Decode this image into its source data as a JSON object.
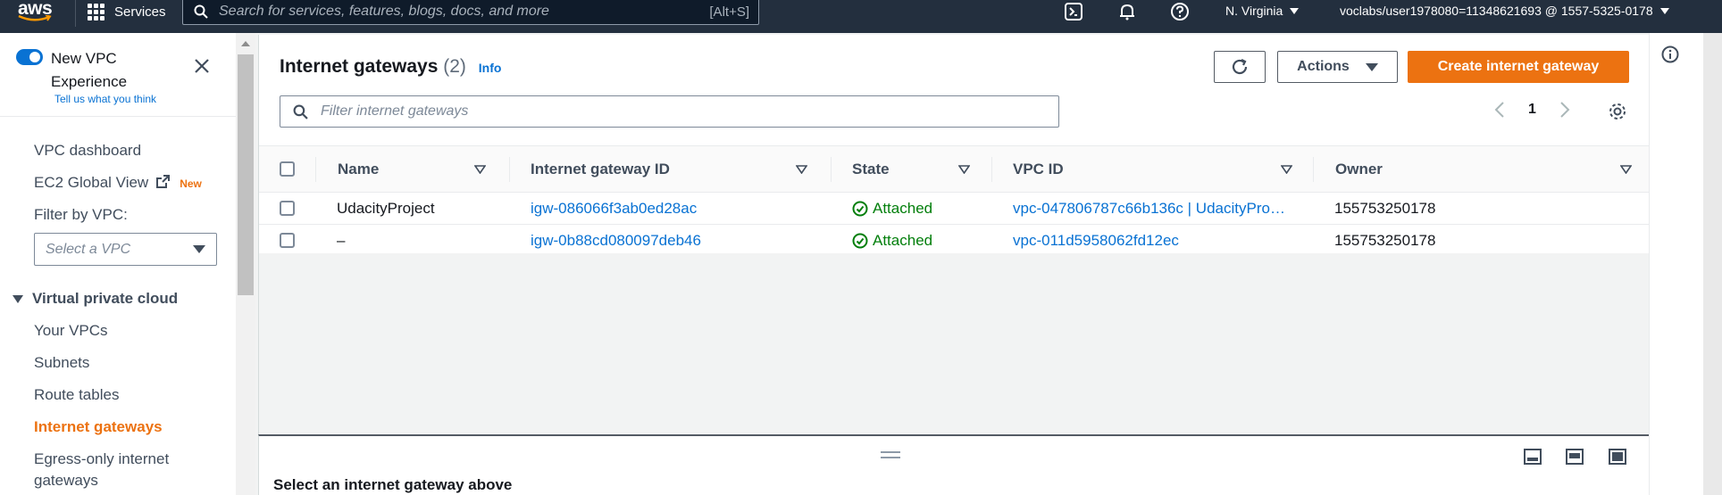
{
  "topnav": {
    "logo": "aws",
    "services_label": "Services",
    "search_placeholder": "Search for services, features, blogs, docs, and more",
    "search_shortcut": "[Alt+S]",
    "region": "N. Virginia",
    "account": "voclabs/user1978080=11348621693 @ 1557-5325-0178"
  },
  "sidebar": {
    "new_vpc_experience": "New VPC Experience",
    "feedback_link": "Tell us what you think",
    "vpc_dashboard": "VPC dashboard",
    "ec2_global_view": "EC2 Global View",
    "new_badge": "New",
    "filter_label": "Filter by VPC:",
    "filter_placeholder": "Select a VPC",
    "section_title": "Virtual private cloud",
    "items": [
      {
        "label": "Your VPCs",
        "active": false
      },
      {
        "label": "Subnets",
        "active": false
      },
      {
        "label": "Route tables",
        "active": false
      },
      {
        "label": "Internet gateways",
        "active": true
      },
      {
        "label": "Egress-only internet",
        "active": false
      }
    ],
    "egress_line2": "gateways"
  },
  "main": {
    "title": "Internet gateways",
    "count": "(2)",
    "info_link": "Info",
    "actions_label": "Actions",
    "create_label": "Create internet gateway",
    "filter_placeholder": "Filter internet gateways",
    "page_number": "1",
    "columns": [
      "Name",
      "Internet gateway ID",
      "State",
      "VPC ID",
      "Owner"
    ],
    "rows": [
      {
        "name": "UdacityProject",
        "igw_id": "igw-086066f3ab0ed28ac",
        "state": "Attached",
        "vpc_id": "vpc-047806787c66b136c | UdacityPro…",
        "owner": "155753250178"
      },
      {
        "name": "–",
        "igw_id": "igw-0b88cd080097deb46",
        "state": "Attached",
        "vpc_id": "vpc-011d5958062fd12ec",
        "owner": "155753250178"
      }
    ]
  },
  "split_panel": {
    "title": "Select an internet gateway above"
  },
  "colors": {
    "nav_bg": "#232f3e",
    "primary_orange": "#ec7211",
    "link_blue": "#0972d3",
    "success_green": "#037f0c"
  }
}
